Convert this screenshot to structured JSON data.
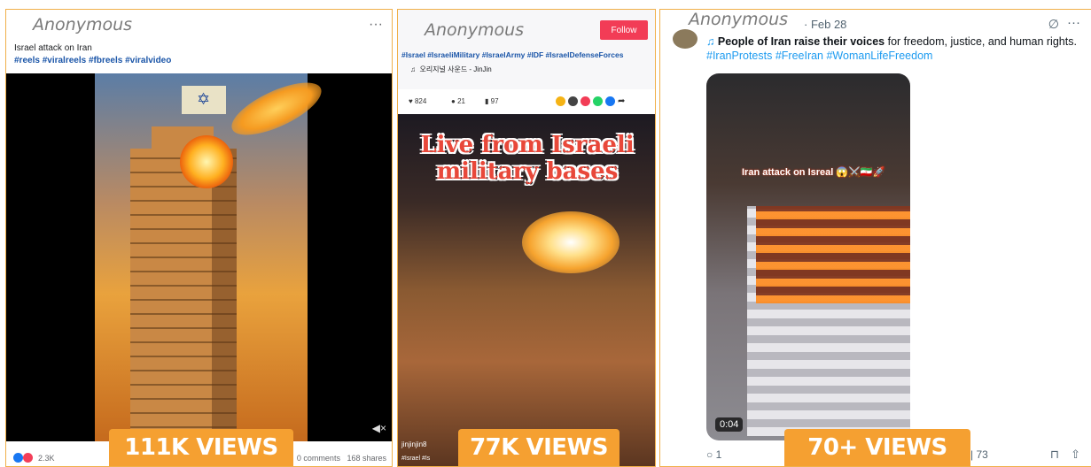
{
  "posts": [
    {
      "author": "Anonymous",
      "menu": "···",
      "caption": "Israel attack on Iran",
      "hashtags": "#reels #viralreels #fbreels #viralvideo",
      "reactions": "2.3K",
      "comments": "0 comments",
      "shares": "168 shares",
      "views_badge": "111K VIEWS"
    },
    {
      "author": "Anonymous",
      "follow_label": "Follow",
      "hashtags": "#Israel #IsraeliMilitary #IsraelArmy #IDF #IsraelDefenseForces",
      "sound": "오리지널 사운드 - JinJin",
      "likes": "824",
      "comments": "21",
      "saves": "97",
      "overlay_text": "Live from Israeli military bases",
      "username_partial": "jinjinjin8",
      "hashtag_partial": "#Israel #Is",
      "views_badge": "77K VIEWS"
    },
    {
      "author": "Anonymous",
      "date": "· Feb 28",
      "text_bold": "People of Iran raise their voices",
      "text_rest": " for freedom, justice, and human rights.",
      "hashtags": "#IranProtests #FreeIran #WomanLifeFreedom",
      "video_overlay": "Iran attack on Isreal 😱⚔️🇮🇷🚀",
      "video_time": "0:04",
      "replies": "1",
      "views": "73",
      "views_badge": "70+ VIEWS"
    }
  ],
  "colors": {
    "badge": "#f5a031",
    "follow": "#f23c56",
    "hashtag_blue": "#1a55a8",
    "x_link": "#1d9bf0"
  }
}
